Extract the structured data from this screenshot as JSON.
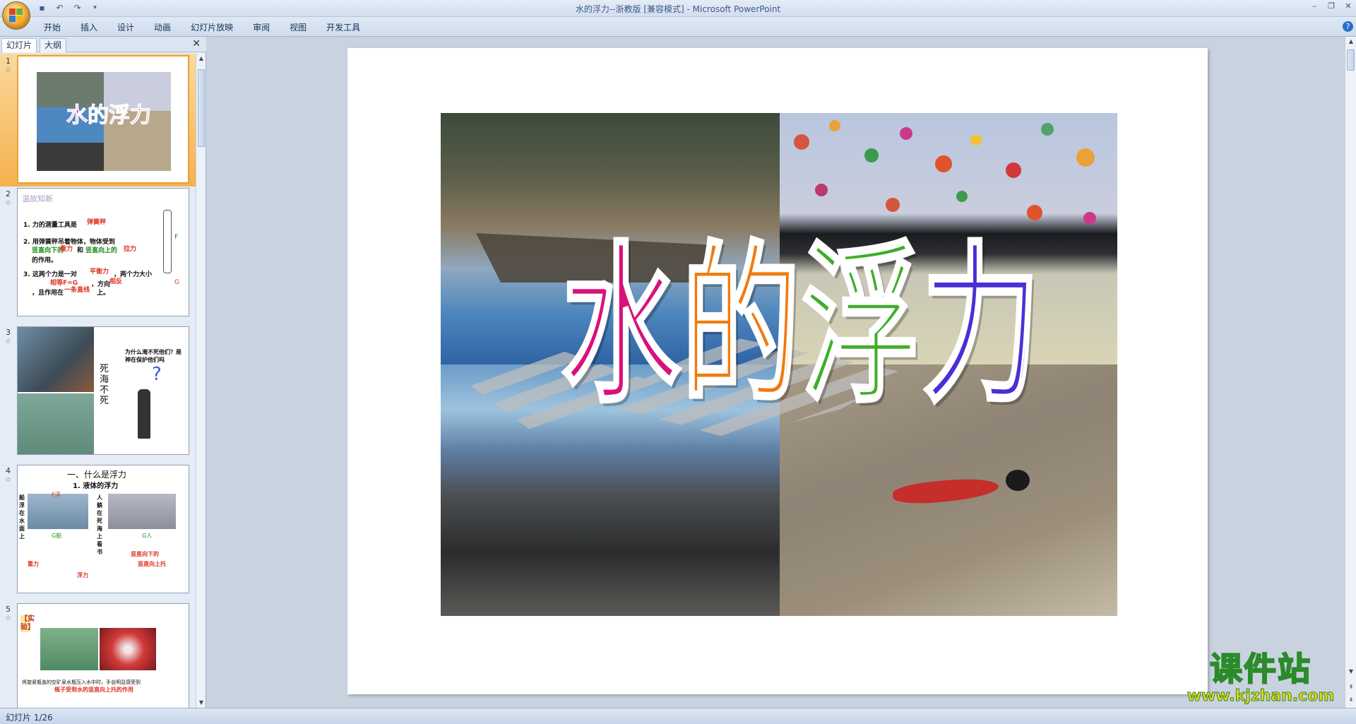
{
  "app": {
    "window_title": "水的浮力--浙教版 [兼容模式] - Microsoft PowerPoint"
  },
  "ribbon": {
    "tabs": [
      "开始",
      "插入",
      "设计",
      "动画",
      "幻灯片放映",
      "审阅",
      "视图",
      "开发工具"
    ]
  },
  "slide_pane": {
    "tabs": [
      "幻灯片",
      "大纲"
    ],
    "thumbnails": [
      {
        "number": "1",
        "text": "水的浮力"
      },
      {
        "number": "2",
        "text": "温故知新",
        "lines": [
          "1. 力的测量工具是",
          "弹簧秤",
          "2. 用弹簧秤吊着物体，物体受到",
          "竖直向下的",
          "重力",
          "和",
          "竖直向上的",
          "拉力",
          "的作用。",
          "3. 这两个力是一对",
          "平衡力",
          "，两个力大小",
          "相等F=G",
          "，方向",
          "相反",
          "，且作用在",
          "一条直线",
          "上。",
          "F",
          "G"
        ]
      },
      {
        "number": "3",
        "text": "死海不死",
        "lines": [
          "为什么淹不死他们？是神在保护他们吗"
        ]
      },
      {
        "number": "4",
        "text": "一、什么是浮力",
        "lines": [
          "1. 液体的浮力",
          "船浮在水面上",
          "人躺在死海上看书",
          "F浮",
          "G船",
          "G人",
          "竖直向下的",
          "重力",
          "竖直向上托",
          "浮力"
        ]
      },
      {
        "number": "5",
        "text": "【实验】",
        "lines": [
          "将旋紧瓶盖的空矿泉水瓶压入水中时，手会明显感受到",
          "瓶子受到水的竖直向上托的作用"
        ]
      }
    ]
  },
  "slide": {
    "title_chars": [
      "水",
      "的",
      "浮",
      "力"
    ],
    "title_colors": [
      "#d8127a",
      "#f07a10",
      "#3fae2a",
      "#4b2fd6"
    ]
  },
  "status": {
    "slide_indicator": "幻灯片 1/26"
  },
  "watermark": {
    "main": "课件站",
    "url": "www.kjzhan.com"
  }
}
